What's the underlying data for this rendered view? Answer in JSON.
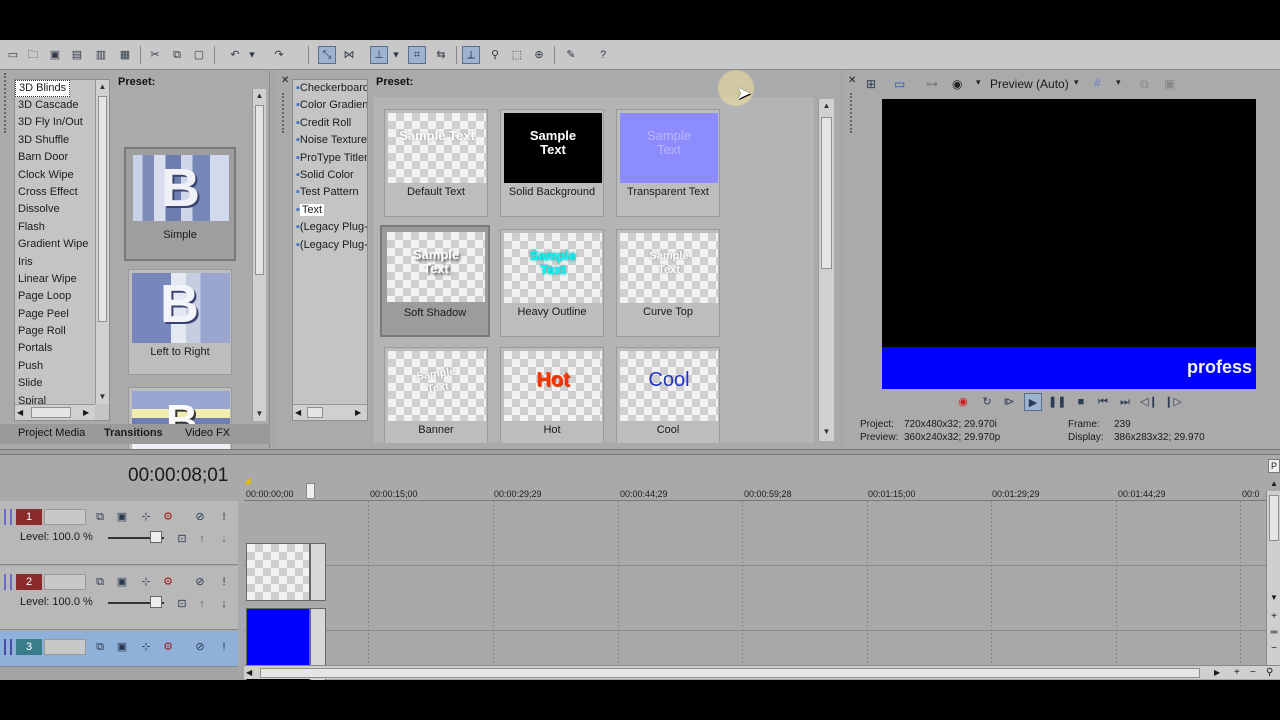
{
  "toolbar": {
    "icons": [
      "new-icon",
      "open-icon",
      "save-icon",
      "save-as-icon",
      "properties-icon",
      "cut-icon",
      "copy-icon",
      "paste-icon",
      "undo-icon",
      "redo-icon",
      "normal-edit-tool-icon",
      "envelope-tool-icon",
      "enable-snapping-icon",
      "auto-crossfade-icon",
      "auto-ripple-icon",
      "lock-envelopes-icon",
      "ignore-grouping-icon",
      "selection-tool-icon",
      "zoom-tool-icon",
      "render-icon",
      "help-icon"
    ]
  },
  "transitions_panel": {
    "list": [
      "3D Blinds",
      "3D Cascade",
      "3D Fly In/Out",
      "3D Shuffle",
      "Barn Door",
      "Clock Wipe",
      "Cross Effect",
      "Dissolve",
      "Flash",
      "Gradient Wipe",
      "Iris",
      "Linear Wipe",
      "Page Loop",
      "Page Peel",
      "Page Roll",
      "Portals",
      "Push",
      "Slide",
      "Spiral"
    ],
    "selected": "3D Blinds",
    "preset_label": "Preset:",
    "presets": [
      "Simple",
      "Left to Right",
      ""
    ],
    "tabs": [
      "Project Media",
      "Transitions",
      "Video FX"
    ],
    "active_tab": "Transitions"
  },
  "media_generators": {
    "list": [
      "Checkerboard",
      "Color Gradient",
      "Credit Roll",
      "Noise Texture",
      "ProType Titler",
      "Solid Color",
      "Test Pattern",
      "Text",
      "(Legacy Plug-in)",
      "(Legacy Plug-in)"
    ],
    "selected": "Text",
    "preset_label": "Preset:",
    "presets": [
      {
        "caption": "Default Text",
        "sample": "Sample Text"
      },
      {
        "caption": "Solid Background",
        "sample": "Sample Text"
      },
      {
        "caption": "Transparent Text",
        "sample": "Sample Text"
      },
      {
        "caption": "Soft Shadow",
        "sample": "Sample Text"
      },
      {
        "caption": "Heavy Outline",
        "sample": "Sample Text"
      },
      {
        "caption": "Curve Top",
        "sample": "Sample Text"
      },
      {
        "caption": "Banner",
        "sample": "Sample Text"
      },
      {
        "caption": "Hot",
        "sample": "Hot"
      },
      {
        "caption": "Cool",
        "sample": "Cool"
      }
    ]
  },
  "preview": {
    "mode_label": "Preview (Auto)",
    "overlay_text": "profess",
    "banner_color": "#0000ff",
    "info": {
      "project_label": "Project:",
      "project_value": "720x480x32; 29.970i",
      "preview_label": "Preview:",
      "preview_value": "360x240x32; 29.970p",
      "frame_label": "Frame:",
      "frame_value": "239",
      "display_label": "Display:",
      "display_value": "386x283x32; 29.970"
    }
  },
  "timeline": {
    "timecode": "00:00:08;01",
    "ruler": [
      "00:00:00;00",
      "00:00:15;00",
      "00:00:29;29",
      "00:00:44;29",
      "00:00:59;28",
      "00:01:15;00",
      "00:01:29;29",
      "00:01:44;29",
      "00:0"
    ],
    "tracks": [
      {
        "number": "1",
        "level": "Level: 100.0 %",
        "color": "#8a2b2b"
      },
      {
        "number": "2",
        "level": "Level: 100.0 %",
        "color": "#8a2b2b"
      },
      {
        "number": "3",
        "level": "",
        "color": "#3a7c8a"
      }
    ]
  },
  "colors": {
    "accent_blue": "#0000ff",
    "hot_text": "#ff3300",
    "cool_text": "#2233cc",
    "heavy_outline": "#33ffff",
    "transparent_bg": "#8c8cff"
  }
}
